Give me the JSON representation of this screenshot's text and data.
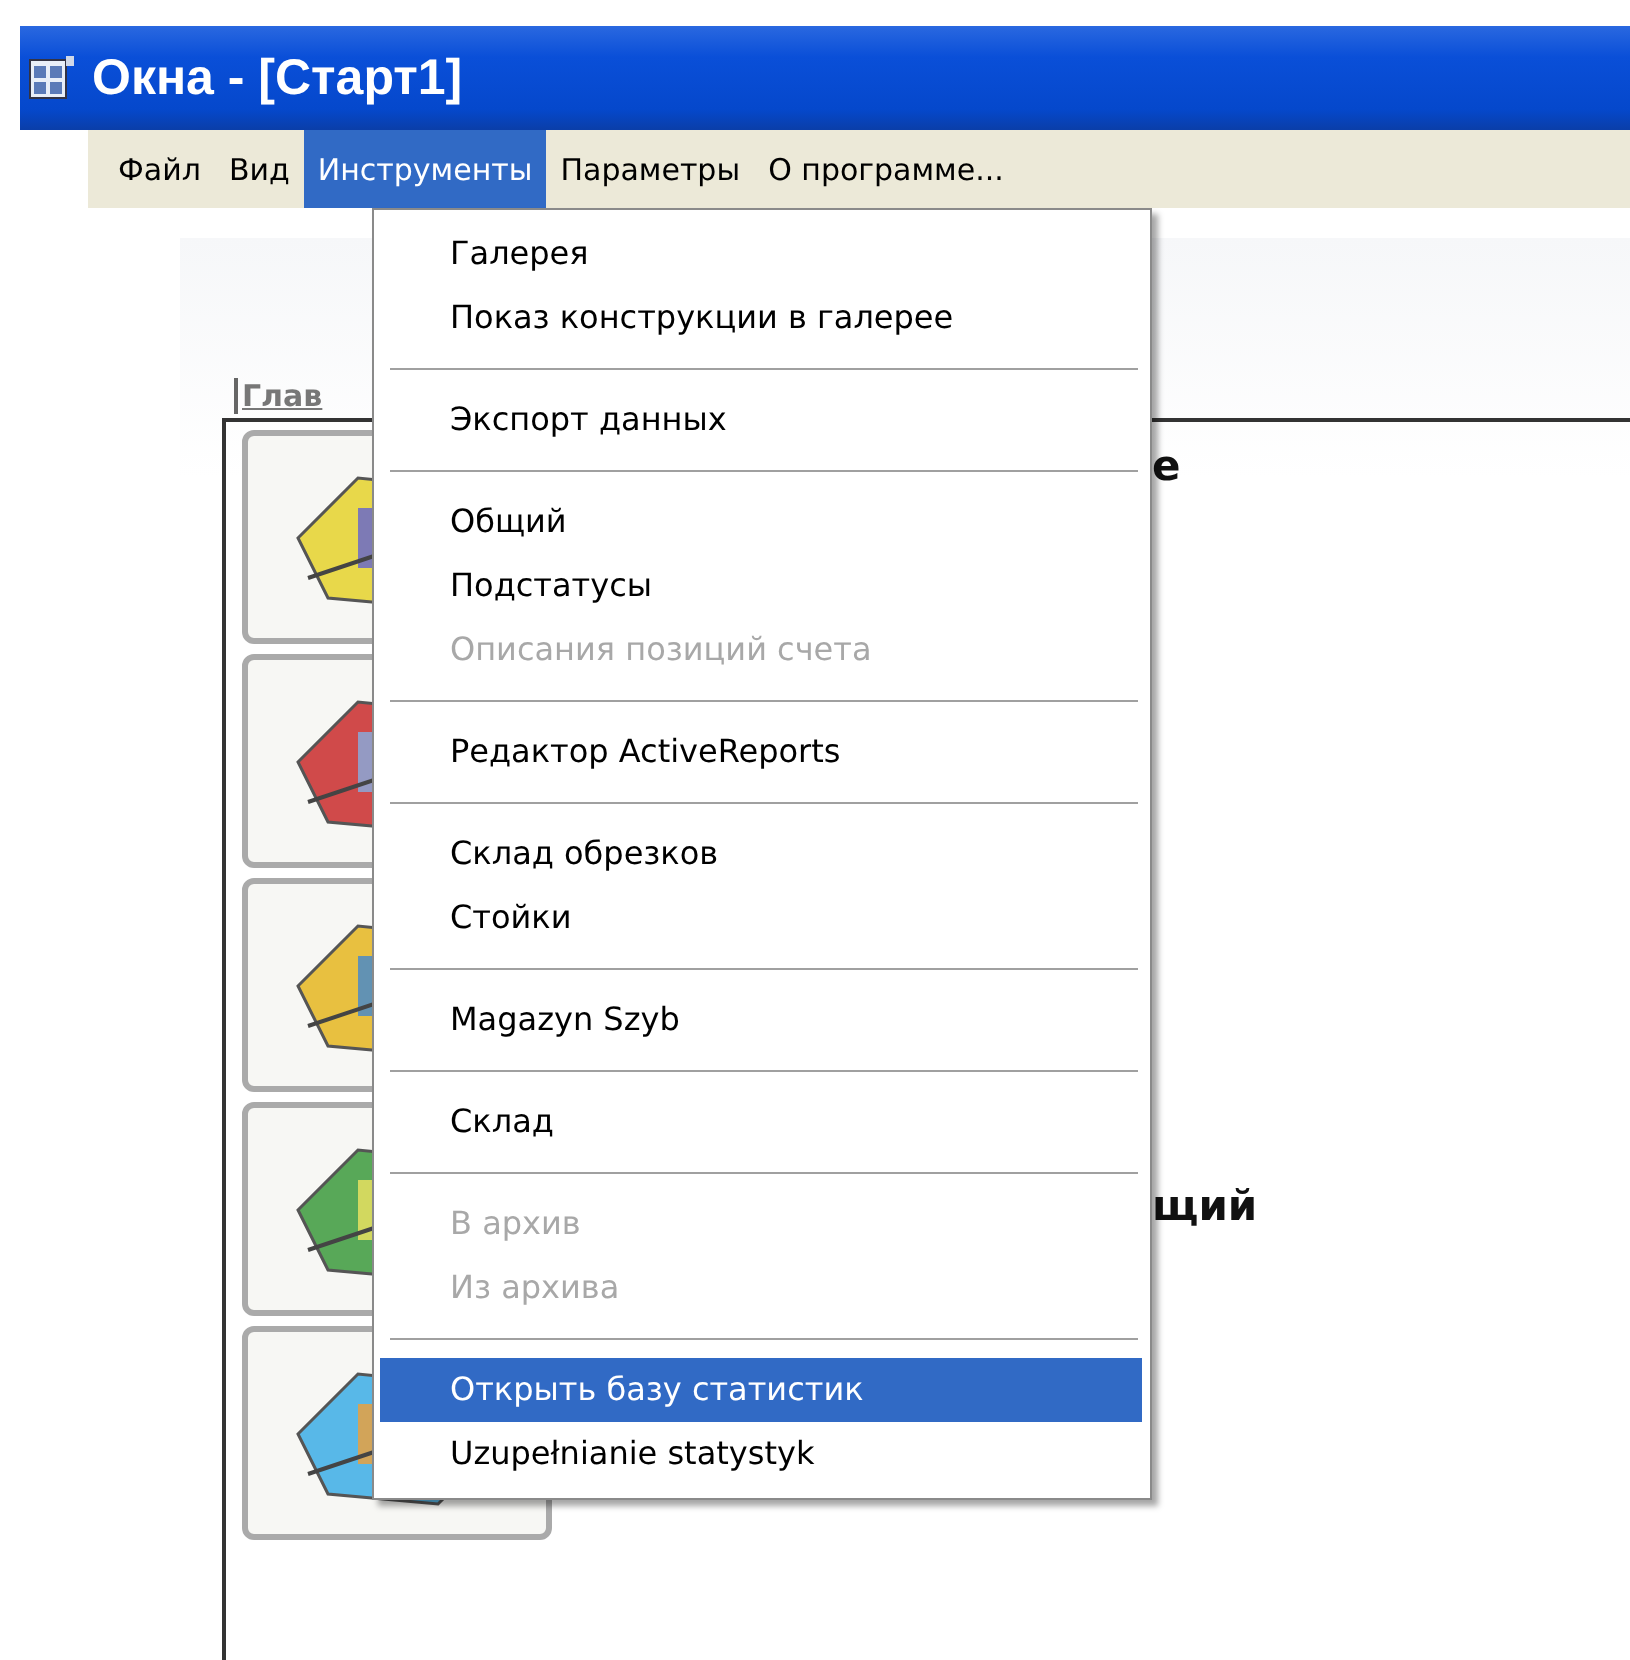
{
  "window": {
    "title": "Окна - [Старт1]"
  },
  "menu_bar": [
    {
      "label": "Файл",
      "selected": false
    },
    {
      "label": "Вид",
      "selected": false
    },
    {
      "label": "Инструменты",
      "selected": true
    },
    {
      "label": "Параметры",
      "selected": false
    },
    {
      "label": "О программе...",
      "selected": false
    }
  ],
  "panel": {
    "tab_label": "Глав",
    "tiles": [
      {
        "kind": "captioned",
        "label": "е"
      },
      {
        "kind": "plain"
      },
      {
        "kind": "plain"
      },
      {
        "kind": "captioned",
        "label": "щий"
      },
      {
        "kind": "plain"
      }
    ]
  },
  "dropdown": [
    {
      "kind": "item",
      "label": "Галерея",
      "disabled": false,
      "selected": false
    },
    {
      "kind": "item",
      "label": "Показ конструкции в галерее",
      "disabled": false,
      "selected": false
    },
    {
      "kind": "separator"
    },
    {
      "kind": "item",
      "label": "Экспорт данных",
      "disabled": false,
      "selected": false
    },
    {
      "kind": "separator"
    },
    {
      "kind": "item",
      "label": "Общий",
      "disabled": false,
      "selected": false
    },
    {
      "kind": "item",
      "label": "Подстатусы",
      "disabled": false,
      "selected": false
    },
    {
      "kind": "item",
      "label": "Описания позиций счета",
      "disabled": true,
      "selected": false
    },
    {
      "kind": "separator"
    },
    {
      "kind": "item",
      "label": "Редактор ActiveReports",
      "disabled": false,
      "selected": false
    },
    {
      "kind": "separator"
    },
    {
      "kind": "item",
      "label": "Склад обрезков",
      "disabled": false,
      "selected": false
    },
    {
      "kind": "item",
      "label": "Стойки",
      "disabled": false,
      "selected": false
    },
    {
      "kind": "separator"
    },
    {
      "kind": "item",
      "label": "Magazyn Szyb",
      "disabled": false,
      "selected": false
    },
    {
      "kind": "separator"
    },
    {
      "kind": "item",
      "label": "Склад",
      "disabled": false,
      "selected": false
    },
    {
      "kind": "separator"
    },
    {
      "kind": "item",
      "label": "В архив",
      "disabled": true,
      "selected": false
    },
    {
      "kind": "item",
      "label": "Из архива",
      "disabled": true,
      "selected": false
    },
    {
      "kind": "separator"
    },
    {
      "kind": "item",
      "label": "Открыть базу статистик",
      "disabled": false,
      "selected": true
    },
    {
      "kind": "item",
      "label": "Uzupełnianie statystyk",
      "disabled": false,
      "selected": false
    }
  ]
}
